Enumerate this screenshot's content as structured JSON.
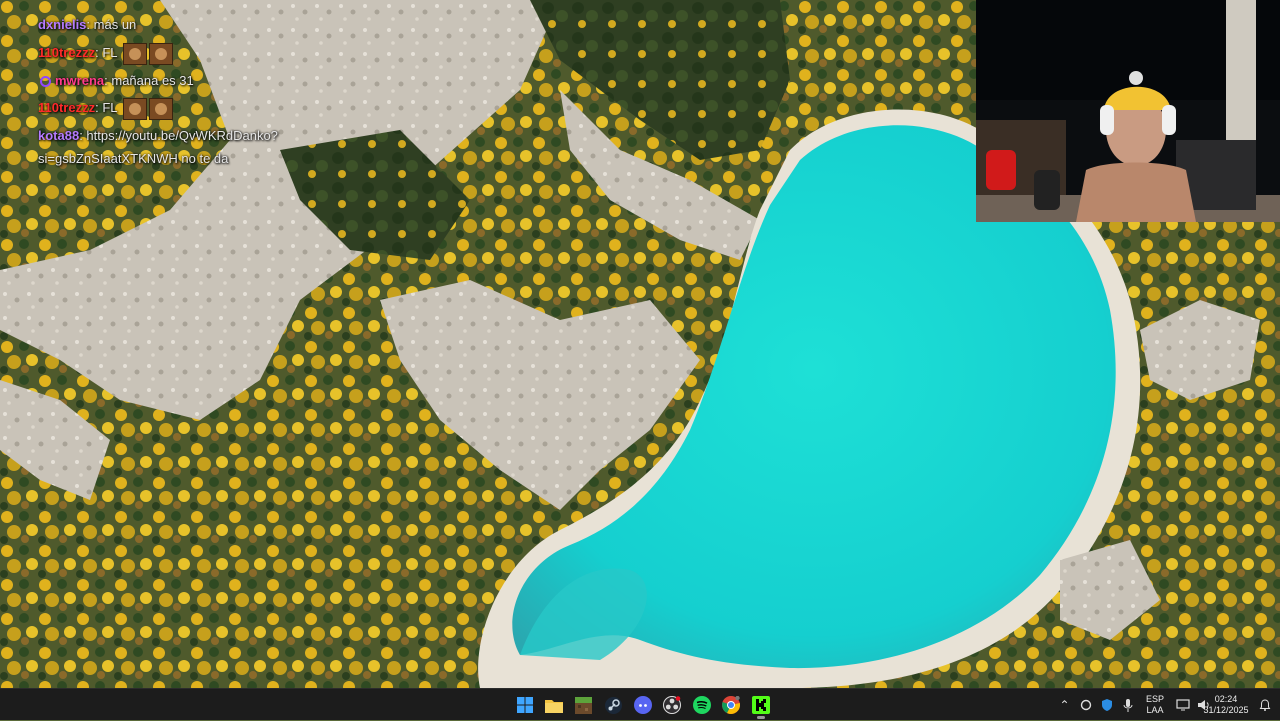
{
  "chat": {
    "messages": [
      {
        "user": "dxnielis",
        "text": ": más un",
        "user_color": "#b57bff",
        "emote": false
      },
      {
        "user": "110trezzz",
        "text": ": FL",
        "user_color": "#ff2a2a",
        "emote": true
      },
      {
        "user": "mwrena",
        "text": ": mañana es 31",
        "user_color": "#ff3b8a",
        "emote": false,
        "badge": true
      },
      {
        "user": "110trezzz",
        "text": ": FL",
        "user_color": "#ff2a2a",
        "emote": true
      },
      {
        "user": "kota88",
        "text": ": https://youtu.be/QvWKRdDanko?",
        "user_color": "#b57bff",
        "emote": false
      }
    ],
    "wrap_line": "si=gsbZnSIaatXTKNWH no te da"
  },
  "webcam": {
    "label": "streamer webcam"
  },
  "taskbar": {
    "apps": [
      {
        "name": "start-button-icon",
        "active": false
      },
      {
        "name": "file-explorer-icon",
        "active": false
      },
      {
        "name": "minecraft-icon",
        "active": false
      },
      {
        "name": "steam-icon",
        "active": false
      },
      {
        "name": "discord-icon",
        "active": false
      },
      {
        "name": "obs-icon",
        "active": false
      },
      {
        "name": "spotify-icon",
        "active": false
      },
      {
        "name": "chrome-icon",
        "active": false
      },
      {
        "name": "kick-icon",
        "active": true
      }
    ],
    "tray": {
      "lang_line1": "ESP",
      "lang_line2": "LAA",
      "time": "02:24",
      "date": "31/12/2025"
    }
  },
  "colors": {
    "lake": "#1fd6d2",
    "taskbar": "#1c1c1c",
    "accent_kick": "#53fc18"
  }
}
